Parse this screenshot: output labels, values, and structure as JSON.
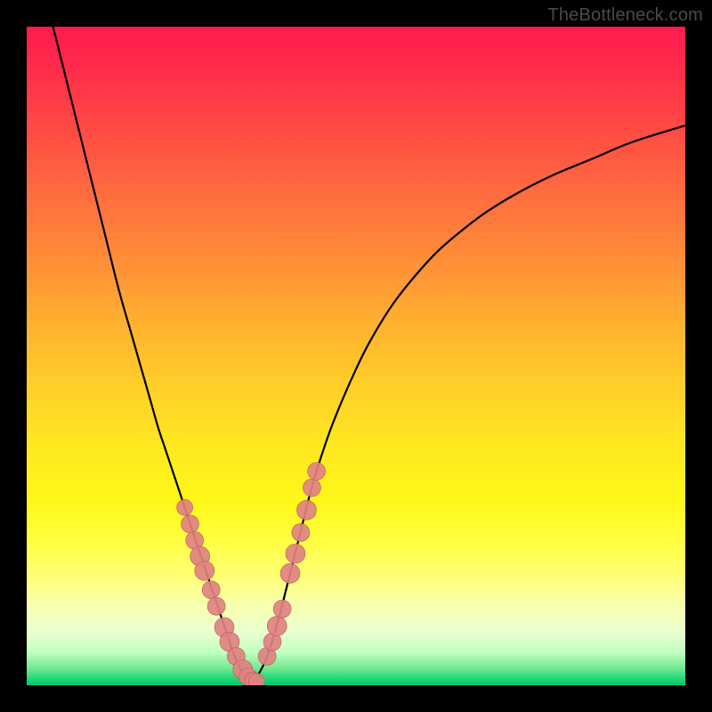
{
  "watermark": "TheBottleneck.com",
  "colors": {
    "curve": "#000000",
    "point_fill": "#e08282",
    "point_stroke": "#c05858"
  },
  "chart_data": {
    "type": "line",
    "title": "",
    "xlabel": "",
    "ylabel": "",
    "xlim": [
      0,
      100
    ],
    "ylim": [
      0,
      100
    ],
    "grid": false,
    "series": [
      {
        "name": "left_curve",
        "x": [
          4.0,
          6.0,
          8.0,
          10.0,
          12.0,
          14.0,
          16.0,
          18.0,
          19.0,
          20.0,
          21.0,
          22.0,
          23.0,
          24.0,
          25.0,
          26.0,
          27.0,
          28.0,
          29.0,
          29.8,
          30.5,
          31.0,
          31.5,
          32.0,
          32.5,
          33.0,
          33.5,
          34.0
        ],
        "y": [
          100.0,
          92.0,
          84.0,
          76.0,
          68.0,
          60.0,
          53.0,
          46.0,
          42.5,
          39.0,
          36.0,
          33.0,
          30.0,
          27.0,
          24.0,
          21.0,
          18.0,
          15.0,
          12.0,
          9.6,
          7.5,
          6.0,
          4.6,
          3.4,
          2.4,
          1.6,
          1.0,
          0.6
        ]
      },
      {
        "name": "right_curve",
        "x": [
          34.0,
          34.5,
          35.0,
          35.5,
          36.0,
          36.5,
          37.0,
          37.5,
          38.0,
          38.5,
          39.0,
          40.0,
          41.0,
          42.0,
          43.0,
          44.0,
          46.0,
          48.0,
          50.0,
          52.0,
          55.0,
          58.0,
          62.0,
          66.0,
          70.0,
          75.0,
          80.0,
          86.0,
          92.0,
          100.0
        ],
        "y": [
          0.6,
          0.9,
          1.4,
          2.2,
          3.2,
          4.4,
          5.8,
          7.4,
          9.2,
          11.0,
          13.0,
          17.0,
          21.0,
          25.0,
          29.0,
          32.5,
          38.5,
          43.5,
          48.0,
          52.0,
          57.0,
          61.0,
          65.5,
          69.0,
          72.0,
          75.0,
          77.5,
          80.0,
          82.5,
          85.0
        ]
      }
    ],
    "points": {
      "left_cluster": {
        "x": [
          24.0,
          24.8,
          25.5,
          26.3,
          27.0,
          28.0,
          28.8,
          30.0,
          30.8,
          31.8,
          32.8,
          33.6,
          34.3,
          34.9
        ],
        "y": [
          27.0,
          24.5,
          22.0,
          19.6,
          17.4,
          14.5,
          12.0,
          8.8,
          6.6,
          4.4,
          2.4,
          1.3,
          0.8,
          0.6
        ],
        "r": [
          9,
          10,
          10,
          11,
          11,
          10,
          10,
          11,
          11,
          10,
          11,
          10,
          9,
          9
        ]
      },
      "right_cluster": {
        "x": [
          36.5,
          37.3,
          38.0,
          38.8,
          40.0,
          40.8,
          41.6,
          42.5,
          43.3,
          44.0
        ],
        "y": [
          4.4,
          6.6,
          9.0,
          11.6,
          17.0,
          20.0,
          23.2,
          26.6,
          30.0,
          32.5
        ],
        "r": [
          10,
          10,
          11,
          10,
          11,
          11,
          10,
          11,
          10,
          10
        ]
      }
    }
  }
}
